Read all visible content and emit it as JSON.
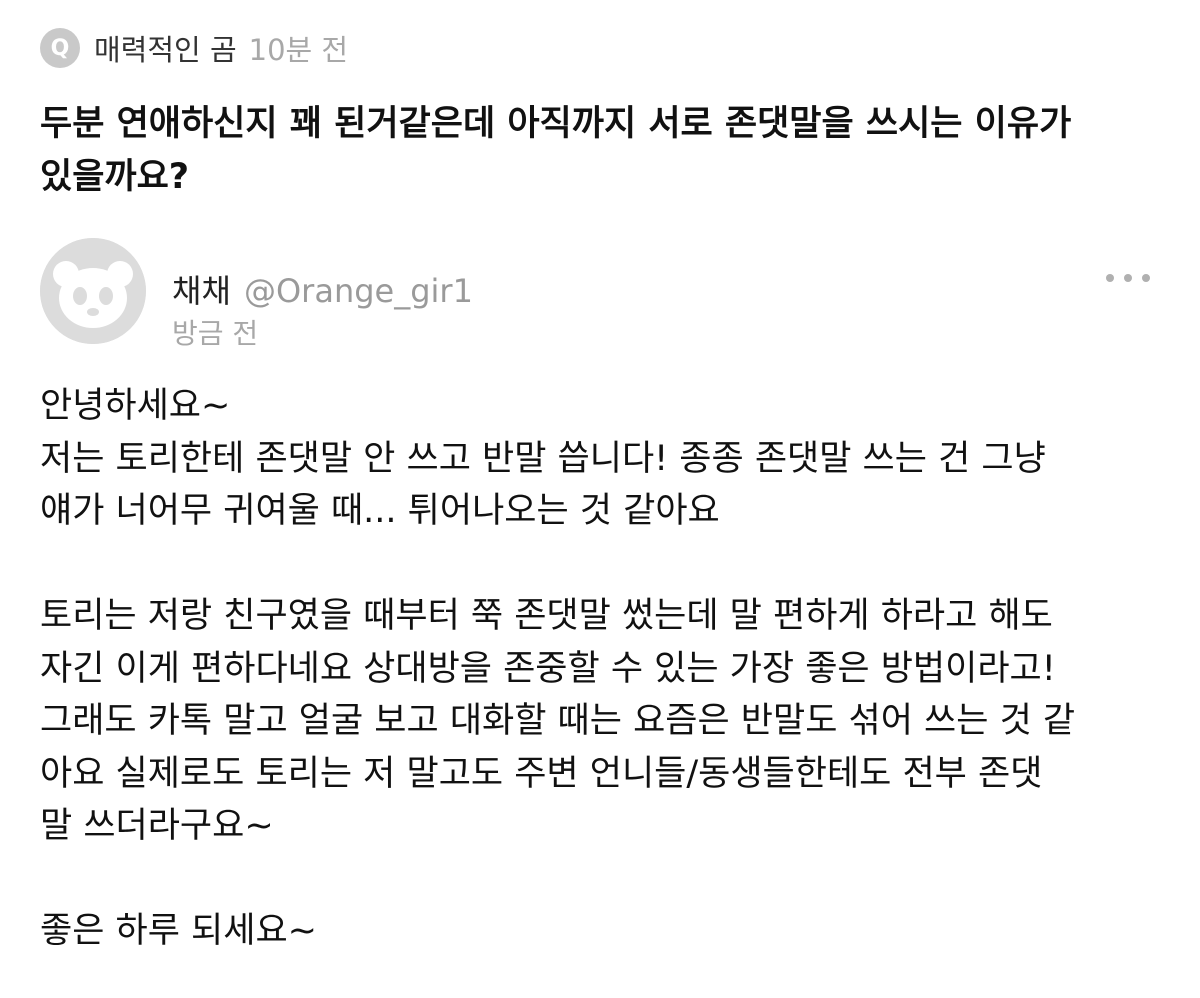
{
  "question": {
    "badge": "Q",
    "asker": "매력적인 곰",
    "time": "10분 전",
    "text": "두분 연애하신지 꽤 된거같은데 아직까지 서로 존댓말을 쓰시는 이유가\n있을까요?"
  },
  "answer": {
    "author_name": "채채",
    "author_handle": "@Orange_gir1",
    "time": "방금 전",
    "more_icon": "more-dots-icon",
    "paragraphs": [
      "안녕하세요~\n저는 토리한테 존댓말 안 쓰고 반말 씁니다! 종종 존댓말 쓰는 건 그냥\n얘가 너어무 귀여울 때... 튀어나오는 것 같아요",
      "토리는 저랑 친구였을 때부터 쭉 존댓말 썼는데 말 편하게 하라고 해도\n자긴 이게 편하다네요 상대방을 존중할 수 있는 가장 좋은 방법이라고!\n그래도 카톡 말고 얼굴 보고 대화할 때는 요즘은 반말도 섞어 쓰는 것 같\n아요 실제로도 토리는 저 말고도 주변 언니들/동생들한테도 전부 존댓\n말 쓰더라구요~",
      "좋은 하루 되세요~"
    ]
  },
  "colors": {
    "badge": "#c9c9c9",
    "muted_text": "#a8a8a8",
    "avatar_bg": "#dcdcdc"
  }
}
